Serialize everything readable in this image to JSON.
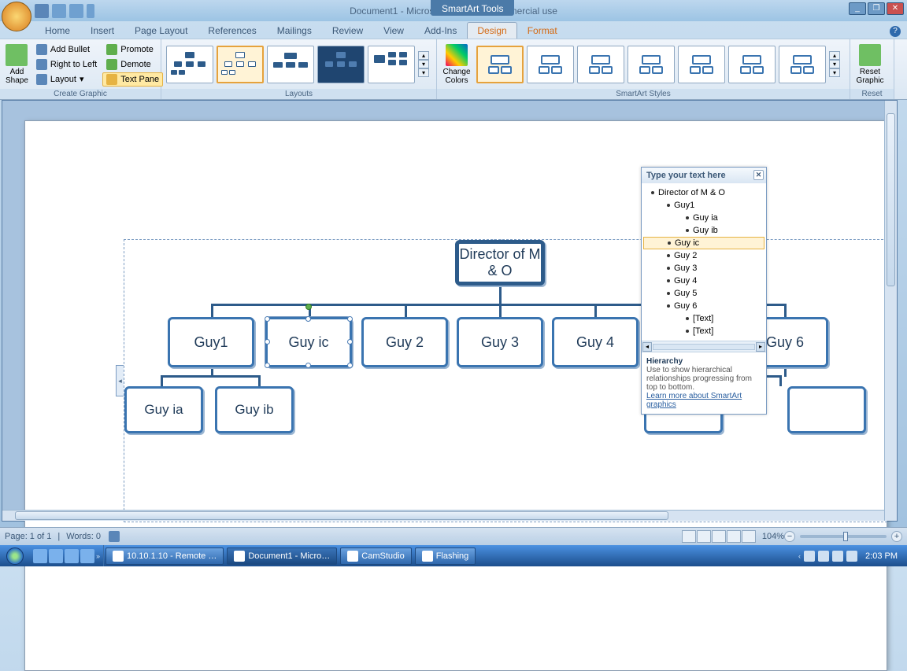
{
  "title": "Document1 - Microsoft Word non-commercial use",
  "smartart_tools_label": "SmartArt Tools",
  "window_buttons": {
    "min": "_",
    "max": "❐",
    "close": "✕"
  },
  "tabs": [
    "Home",
    "Insert",
    "Page Layout",
    "References",
    "Mailings",
    "Review",
    "View",
    "Add-Ins",
    "Design",
    "Format"
  ],
  "active_tab_index": 8,
  "ribbon": {
    "create_graphic": {
      "label": "Create Graphic",
      "add_shape": "Add\nShape",
      "add_bullet": "Add Bullet",
      "right_to_left": "Right to Left",
      "layout": "Layout",
      "promote": "Promote",
      "demote": "Demote",
      "text_pane": "Text Pane"
    },
    "layouts_label": "Layouts",
    "change_colors": "Change\nColors",
    "styles_label": "SmartArt Styles",
    "reset_graphic": "Reset\nGraphic",
    "reset_label": "Reset"
  },
  "textpane": {
    "title": "Type your text here",
    "items": [
      {
        "level": 1,
        "text": "Director of M & O"
      },
      {
        "level": 2,
        "text": "Guy1"
      },
      {
        "level": 3,
        "text": "Guy ia"
      },
      {
        "level": 3,
        "text": "Guy ib"
      },
      {
        "level": 2,
        "text": "Guy ic",
        "selected": true
      },
      {
        "level": 2,
        "text": "Guy 2"
      },
      {
        "level": 2,
        "text": "Guy 3"
      },
      {
        "level": 2,
        "text": "Guy 4"
      },
      {
        "level": 2,
        "text": "Guy 5"
      },
      {
        "level": 2,
        "text": "Guy 6"
      },
      {
        "level": 3,
        "text": "[Text]"
      },
      {
        "level": 3,
        "text": "[Text]"
      }
    ],
    "desc_title": "Hierarchy",
    "desc_body": "Use to show hierarchical relationships progressing from top to bottom.",
    "desc_link": "Learn more about SmartArt graphics"
  },
  "chart_data": {
    "type": "hierarchy",
    "root": "Director of M & O",
    "nodes": [
      {
        "label": "Guy1",
        "children": [
          "Guy ia",
          "Guy ib"
        ]
      },
      {
        "label": "Guy ic",
        "selected": true
      },
      {
        "label": "Guy 2"
      },
      {
        "label": "Guy 3"
      },
      {
        "label": "Guy 4"
      },
      {
        "label": "Guy 5"
      },
      {
        "label": "Guy 6",
        "children": [
          "",
          ""
        ]
      }
    ]
  },
  "statusbar": {
    "page": "Page: 1 of 1",
    "words": "Words: 0",
    "zoom": "104%"
  },
  "taskbar": {
    "tasks": [
      {
        "label": "10.10.1.10 - Remote …"
      },
      {
        "label": "Document1 - Micro…",
        "active": true
      },
      {
        "label": "CamStudio"
      },
      {
        "label": "Flashing"
      }
    ],
    "clock": "2:03 PM"
  }
}
